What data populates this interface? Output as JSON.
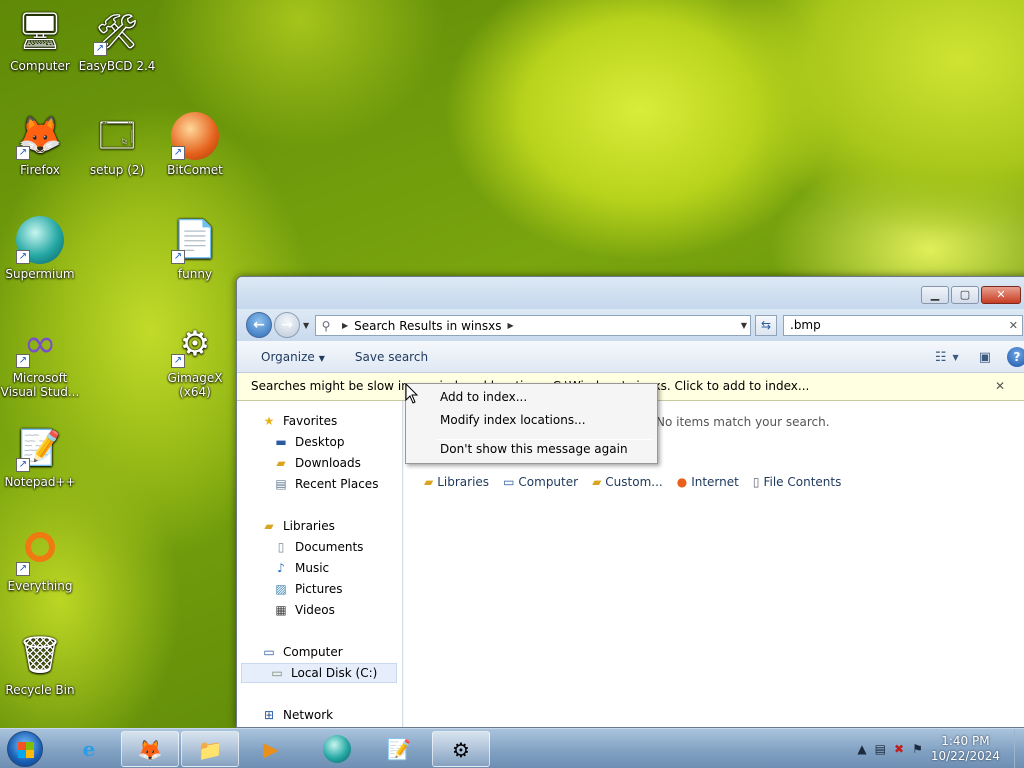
{
  "desktop": {
    "icons": [
      {
        "label": "Computer",
        "glyph": "🖥"
      },
      {
        "label": "EasyBCD 2.4",
        "glyph": "🛠"
      },
      {
        "label": "Firefox",
        "glyph": "🦊"
      },
      {
        "label": "setup (2)",
        "glyph": "🗔"
      },
      {
        "label": "BitComet",
        "glyph": "◐"
      },
      {
        "label": "Supermium",
        "glyph": "◉"
      },
      {
        "label": "funny",
        "glyph": "📄"
      },
      {
        "label": "Microsoft Visual Stud...",
        "glyph": "∞"
      },
      {
        "label": "GimageX (x64)",
        "glyph": "⚙"
      },
      {
        "label": "Notepad++",
        "glyph": "📝"
      },
      {
        "label": "Everything",
        "glyph": "◯"
      },
      {
        "label": "Recycle Bin",
        "glyph": "🗑"
      }
    ]
  },
  "explorer": {
    "caption": {
      "minimize": "▁",
      "maximize": "▢",
      "close": "✕"
    },
    "address": {
      "path": "Search Results in winsxs",
      "search_value": ".bmp"
    },
    "toolbar": {
      "organize": "Organize",
      "save_search": "Save search"
    },
    "infobar": {
      "message": "Searches might be slow in non-indexed locations: C:\\Windows\\winsxs. Click to add to index..."
    },
    "nav": {
      "favorites": "Favorites",
      "desktop": "Desktop",
      "downloads": "Downloads",
      "recent": "Recent Places",
      "libraries": "Libraries",
      "documents": "Documents",
      "music": "Music",
      "pictures": "Pictures",
      "videos": "Videos",
      "computer": "Computer",
      "local_disk": "Local Disk (C:)",
      "network": "Network"
    },
    "content": {
      "no_items": "No items match your search.",
      "search_again": {
        "libraries": "Libraries",
        "computer": "Computer",
        "custom": "Custom...",
        "internet": "Internet",
        "file_contents": "File Contents"
      }
    }
  },
  "context_menu": {
    "add_to_index": "Add to index...",
    "modify_locations": "Modify index locations...",
    "dont_show": "Don't show this message again"
  },
  "taskbar": {
    "time": "1:40 PM",
    "date": "10/22/2024"
  }
}
